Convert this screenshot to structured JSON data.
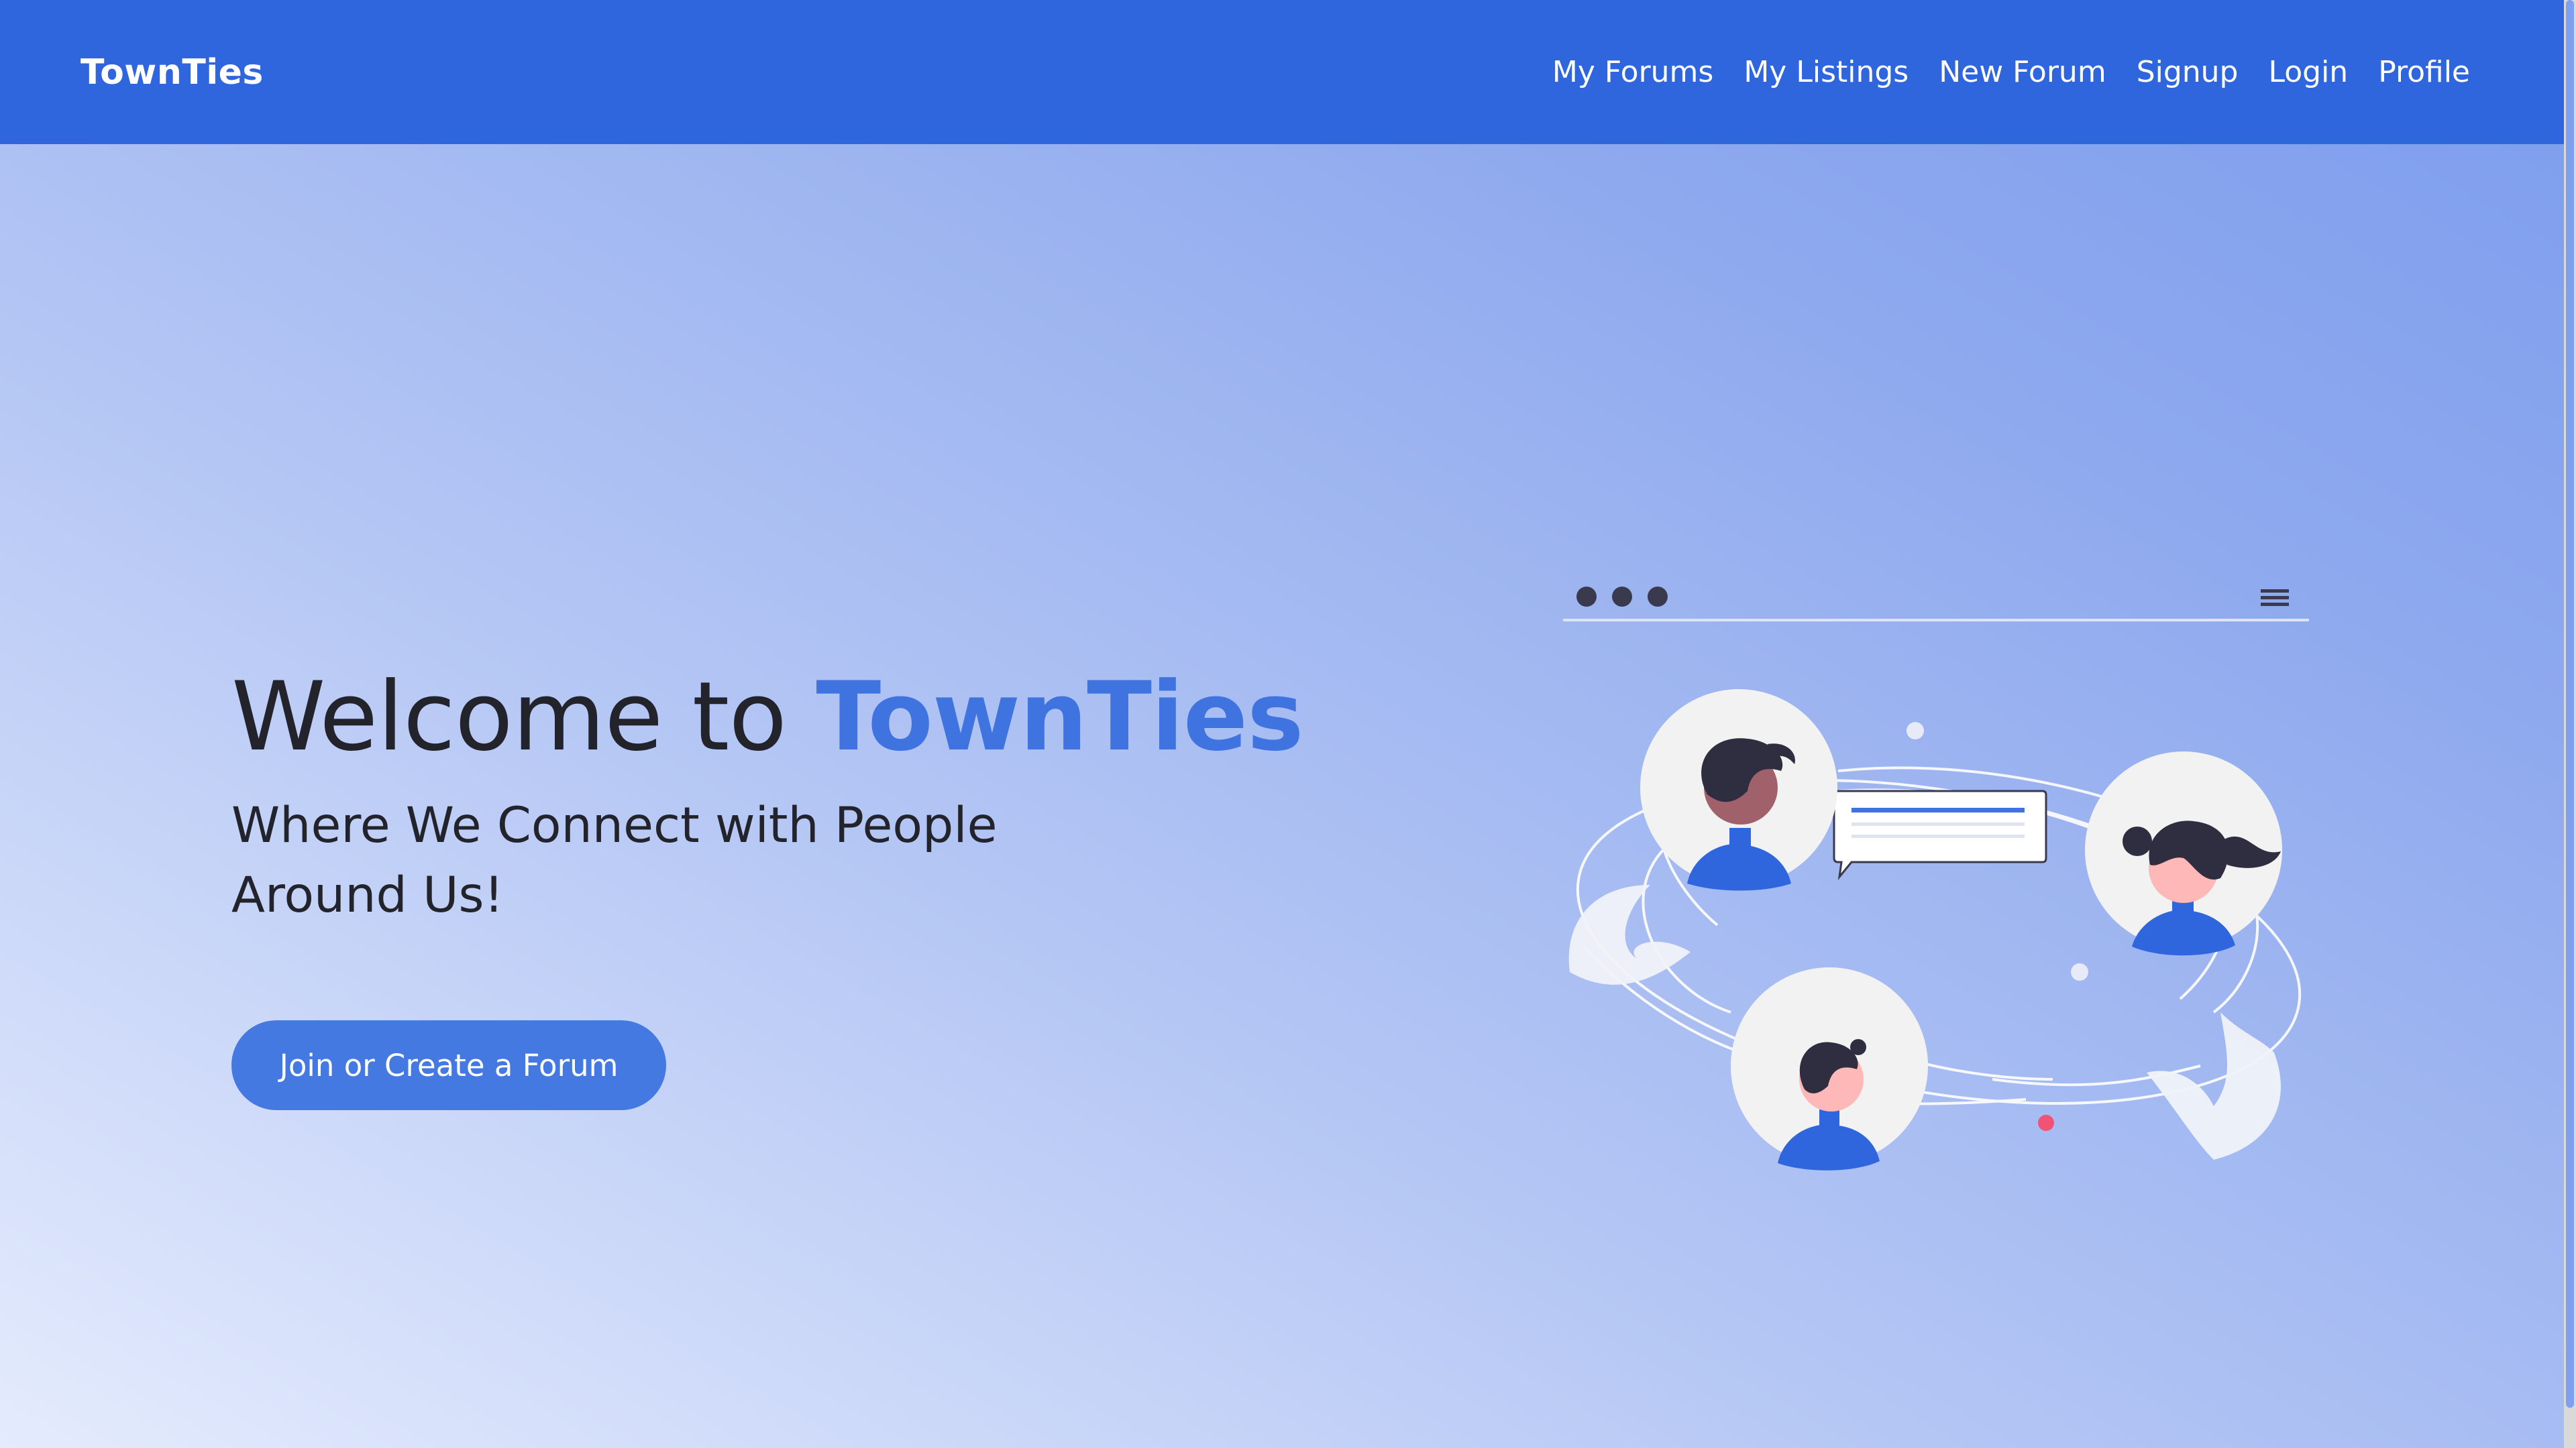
{
  "nav": {
    "brand": "TownTies",
    "links": [
      "My Forums",
      "My Listings",
      "New Forum",
      "Signup",
      "Login",
      "Profile"
    ]
  },
  "hero": {
    "title_prefix": "Welcome to ",
    "title_brand": "TownTies",
    "subtitle": "Where We Connect with People Around Us!",
    "cta_label": "Join or Create a Forum"
  },
  "icons": {
    "menu": "hamburger-menu-icon",
    "window_dots": "window-dots-icon"
  },
  "colors": {
    "navbar": "#2f66dd",
    "accent": "#3f74e0",
    "button": "#4479e2",
    "text": "#23232c"
  }
}
